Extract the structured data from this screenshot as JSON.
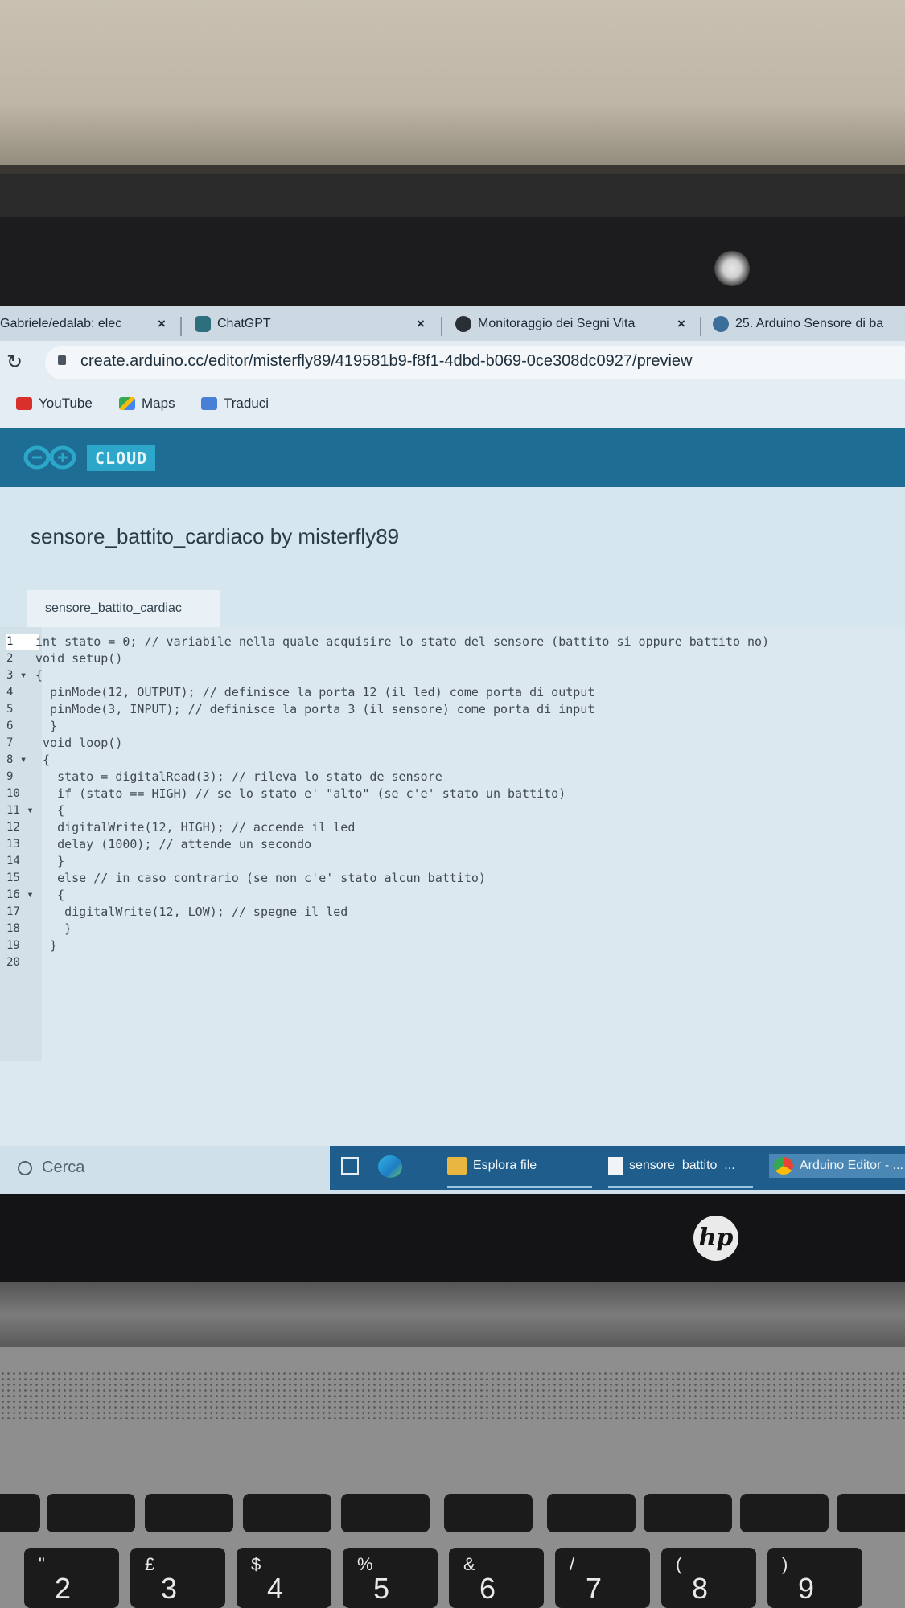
{
  "browser": {
    "tabs": [
      {
        "label": "Gabriele/edalab: electr",
        "close": "×"
      },
      {
        "label": "ChatGPT",
        "close": "×"
      },
      {
        "label": "Monitoraggio dei Segni Vita",
        "close": "×"
      },
      {
        "label": "25. Arduino Sensore di ba"
      }
    ],
    "url": "create.arduino.cc/editor/misterfly89/419581b9-f8f1-4dbd-b069-0ce308dc0927/preview",
    "bookmarks": [
      "YouTube",
      "Maps",
      "Traduci"
    ]
  },
  "app": {
    "brand_label": "CLOUD",
    "sketch_title": "sensore_battito_cardiaco by misterfly89",
    "file_tab": "sensore_battito_cardiac"
  },
  "editor": {
    "lines": [
      {
        "n": "1",
        "code": "int stato = 0; // variabile nella quale acquisire lo stato del sensore (battito si oppure battito no)"
      },
      {
        "n": "2",
        "code": "void setup()"
      },
      {
        "n": "3 ▾",
        "code": "{"
      },
      {
        "n": "4",
        "code": "  pinMode(12, OUTPUT); // definisce la porta 12 (il led) come porta di output"
      },
      {
        "n": "5",
        "code": "  pinMode(3, INPUT); // definisce la porta 3 (il sensore) come porta di input"
      },
      {
        "n": "6",
        "code": "  }"
      },
      {
        "n": "7",
        "code": " void loop()"
      },
      {
        "n": "8 ▾",
        "code": " {"
      },
      {
        "n": "9",
        "code": "   stato = digitalRead(3); // rileva lo stato de sensore"
      },
      {
        "n": "10",
        "code": "   if (stato == HIGH) // se lo stato e' \"alto\" (se c'e' stato un battito)"
      },
      {
        "n": "11 ▾",
        "code": "   {"
      },
      {
        "n": "12",
        "code": "   digitalWrite(12, HIGH); // accende il led"
      },
      {
        "n": "13",
        "code": "   delay (1000); // attende un secondo"
      },
      {
        "n": "14",
        "code": "   }"
      },
      {
        "n": "15",
        "code": "   else // in caso contrario (se non c'e' stato alcun battito)"
      },
      {
        "n": "16 ▾",
        "code": "   {"
      },
      {
        "n": "17",
        "code": "    digitalWrite(12, LOW); // spegne il led"
      },
      {
        "n": "18",
        "code": "    }"
      },
      {
        "n": "19",
        "code": "  }"
      },
      {
        "n": "20",
        "code": ""
      }
    ]
  },
  "taskbar": {
    "search": "Cerca",
    "items": [
      "Esplora file",
      "sensore_battito_...",
      "Arduino Editor - ..."
    ]
  },
  "laptop": {
    "logo": "hp",
    "keys": [
      {
        "main": "2",
        "sub": "\""
      },
      {
        "main": "3",
        "sub": "£"
      },
      {
        "main": "4",
        "sub": "$"
      },
      {
        "main": "5",
        "sub": "%"
      },
      {
        "main": "6",
        "sub": "&"
      },
      {
        "main": "7",
        "sub": "/"
      },
      {
        "main": "8",
        "sub": "("
      },
      {
        "main": "9",
        "sub": ")"
      }
    ]
  },
  "colors": {
    "cloud_bar": "#1d6d94",
    "cloud_label": "#2ca7c9",
    "taskbar_dark": "#1f5e8c"
  }
}
